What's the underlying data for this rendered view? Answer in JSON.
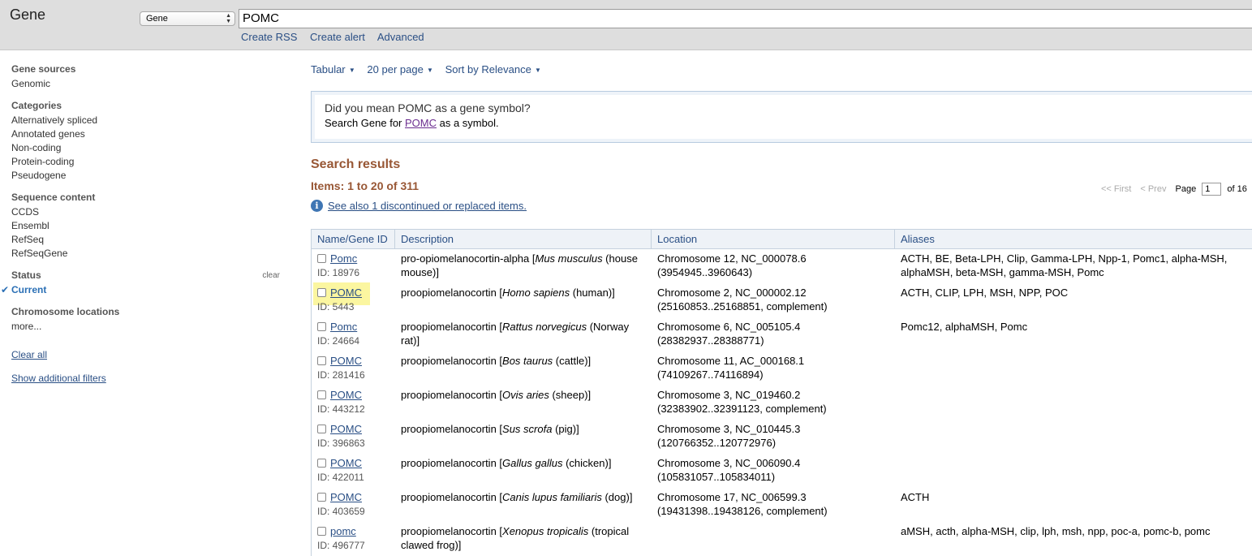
{
  "header": {
    "title": "Gene",
    "db_select": "Gene",
    "search_value": "POMC",
    "links": [
      "Create RSS",
      "Create alert",
      "Advanced"
    ]
  },
  "sidebar": {
    "gene_sources": {
      "heading": "Gene sources",
      "items": [
        "Genomic"
      ]
    },
    "categories": {
      "heading": "Categories",
      "items": [
        "Alternatively spliced",
        "Annotated genes",
        "Non-coding",
        "Protein-coding",
        "Pseudogene"
      ]
    },
    "sequence_content": {
      "heading": "Sequence content",
      "items": [
        "CCDS",
        "Ensembl",
        "RefSeq",
        "RefSeqGene"
      ]
    },
    "status": {
      "heading": "Status",
      "clear": "clear",
      "selected": "Current"
    },
    "chromosome": {
      "heading": "Chromosome locations",
      "more": "more..."
    },
    "clear_all": "Clear all",
    "show_filters": "Show additional filters"
  },
  "display": {
    "format": "Tabular",
    "per_page": "20 per page",
    "sort": "Sort by Relevance"
  },
  "suggestion": {
    "question": "Did you mean POMC as a gene symbol?",
    "prefix": "Search Gene for ",
    "link": "POMC",
    "suffix": " as a symbol."
  },
  "results": {
    "title": "Search results",
    "items_label": "Items: 1 to 20 of 311",
    "see_also": "See also 1 discontinued or replaced items.",
    "pager": {
      "first": "<< First",
      "prev": "< Prev",
      "page_label": "Page",
      "page": "1",
      "of": "of 16"
    },
    "columns": [
      "Name/Gene ID",
      "Description",
      "Location",
      "Aliases"
    ],
    "rows": [
      {
        "name": "Pomc",
        "id": "ID: 18976",
        "desc": "pro-opiomelanocortin-alpha [",
        "species": "Mus musculus",
        "common": " (house mouse)]",
        "loc1": "Chromosome 12, NC_000078.6",
        "loc2": "(3954945..3960643)",
        "aliases": "ACTH, BE, Beta-LPH, Clip, Gamma-LPH, Npp-1, Pomc1, alpha-MSH, alphaMSH, beta-MSH, gamma-MSH, Pomc"
      },
      {
        "name": "POMC",
        "id": "ID: 5443",
        "desc": "proopiomelanocortin [",
        "species": "Homo sapiens",
        "common": " (human)]",
        "loc1": "Chromosome 2, NC_000002.12",
        "loc2": "(25160853..25168851, complement)",
        "aliases": "ACTH, CLIP, LPH, MSH, NPP, POC"
      },
      {
        "name": "Pomc",
        "id": "ID: 24664",
        "desc": "proopiomelanocortin [",
        "species": "Rattus norvegicus",
        "common": " (Norway rat)]",
        "loc1": "Chromosome 6, NC_005105.4",
        "loc2": "(28382937..28388771)",
        "aliases": "Pomc12, alphaMSH, Pomc"
      },
      {
        "name": "POMC",
        "id": "ID: 281416",
        "desc": "proopiomelanocortin [",
        "species": "Bos taurus",
        "common": " (cattle)]",
        "loc1": "Chromosome 11, AC_000168.1",
        "loc2": "(74109267..74116894)",
        "aliases": ""
      },
      {
        "name": "POMC",
        "id": "ID: 443212",
        "desc": "proopiomelanocortin [",
        "species": "Ovis aries",
        "common": " (sheep)]",
        "loc1": "Chromosome 3, NC_019460.2",
        "loc2": "(32383902..32391123, complement)",
        "aliases": ""
      },
      {
        "name": "POMC",
        "id": "ID: 396863",
        "desc": "proopiomelanocortin [",
        "species": "Sus scrofa",
        "common": " (pig)]",
        "loc1": "Chromosome 3, NC_010445.3",
        "loc2": "(120766352..120772976)",
        "aliases": ""
      },
      {
        "name": "POMC",
        "id": "ID: 422011",
        "desc": "proopiomelanocortin [",
        "species": "Gallus gallus",
        "common": " (chicken)]",
        "loc1": "Chromosome 3, NC_006090.4",
        "loc2": "(105831057..105834011)",
        "aliases": ""
      },
      {
        "name": "POMC",
        "id": "ID: 403659",
        "desc": "proopiomelanocortin [",
        "species": "Canis lupus familiaris",
        "common": " (dog)]",
        "loc1": "Chromosome 17, NC_006599.3",
        "loc2": "(19431398..19438126, complement)",
        "aliases": "ACTH"
      },
      {
        "name": "pomc",
        "id": "ID: 496777",
        "desc": "proopiomelanocortin [",
        "species": "Xenopus tropicalis",
        "common": " (tropical clawed frog)]",
        "loc1": "",
        "loc2": "",
        "aliases": "aMSH, acth, alpha-MSH, clip, lph, msh, npp, poc-a, pomc-b, pomc"
      }
    ]
  },
  "colors": {
    "link": "#2a4f85",
    "results_heading": "#985735",
    "highlight": "#fbf6a0"
  }
}
